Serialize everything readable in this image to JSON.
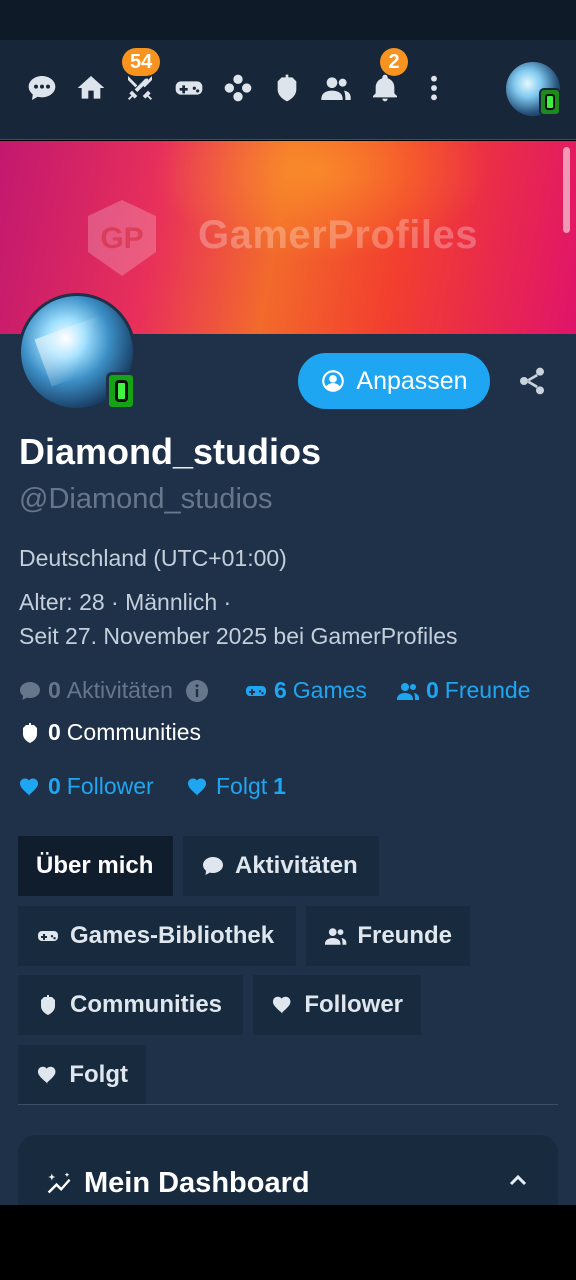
{
  "navbar": {
    "badges": {
      "battles": "54",
      "notifications": "2"
    },
    "icons": [
      "chat-icon",
      "home-icon",
      "swords-icon",
      "gamepad-icon",
      "dpad-icon",
      "shield-icon",
      "friends-icon",
      "bell-icon",
      "more-icon"
    ]
  },
  "banner": {
    "brand_text": "GamerProfiles"
  },
  "profile": {
    "customize_label": "Anpassen",
    "display_name": "Diamond_studios",
    "handle": "@Diamond_studios",
    "country": "Deutschland (UTC+01:00)",
    "age_gender": "Alter: 28  ·  Männlich  ·",
    "member_since": "Seit 27. November 2025 bei GamerProfiles"
  },
  "stats": {
    "activities_count": "0",
    "activities_label": "Aktivitäten",
    "games_count": "6",
    "games_label": "Games",
    "friends_count": "0",
    "friends_label": "Freunde",
    "communities_count": "0",
    "communities_label": "Communities",
    "follower_count": "0",
    "follower_label": "Follower",
    "following_label": "Folgt",
    "following_count": "1"
  },
  "tabs": {
    "about": "Über mich",
    "activities": "Aktivitäten",
    "library": "Games-Bibliothek",
    "friends": "Freunde",
    "communities": "Communities",
    "follower": "Follower",
    "following": "Folgt"
  },
  "dashboard": {
    "title": "Mein Dashboard"
  },
  "colors": {
    "accent": "#1ea6f2",
    "badge": "#f7931e",
    "online": "#3ff03f",
    "background": "#1e3148"
  }
}
